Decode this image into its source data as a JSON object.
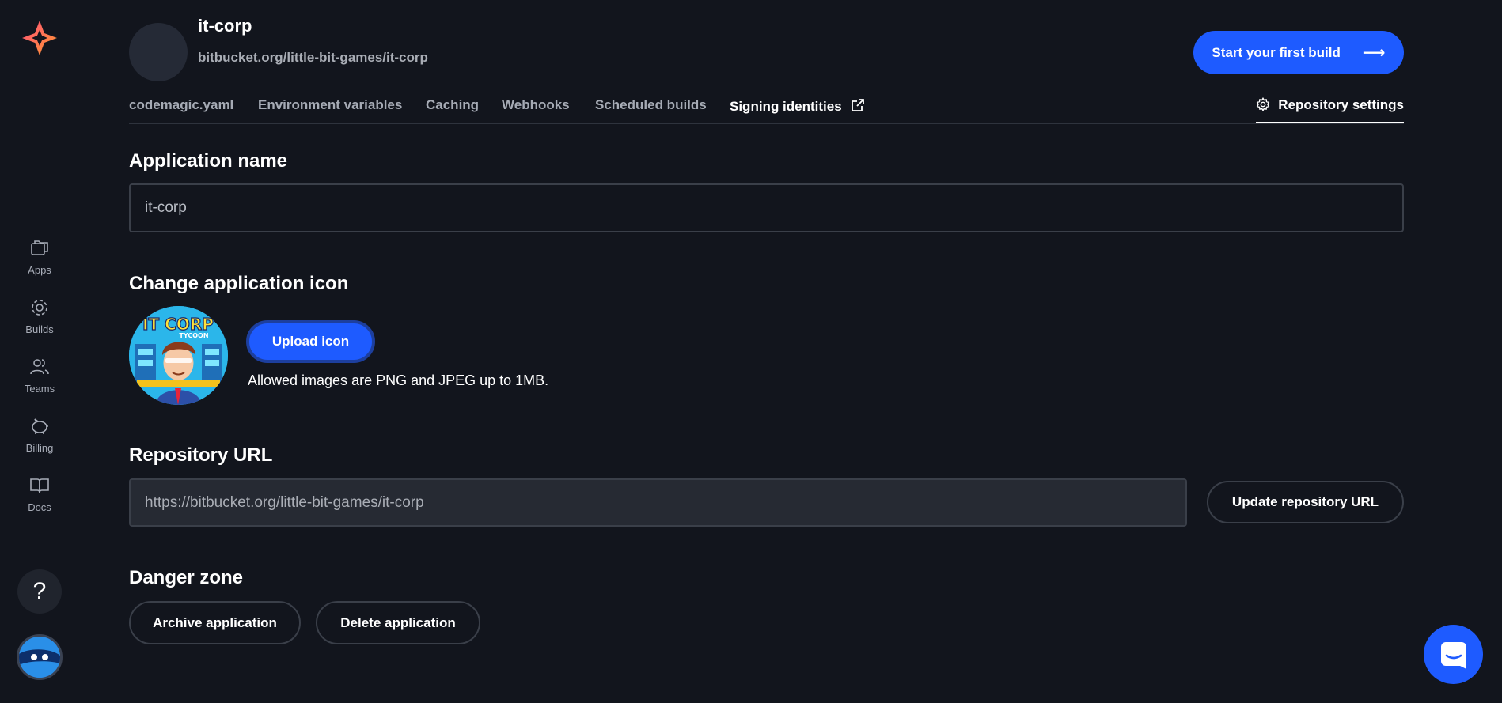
{
  "sidebar": {
    "items": [
      {
        "label": "Apps",
        "icon": "apps-icon"
      },
      {
        "label": "Builds",
        "icon": "builds-icon"
      },
      {
        "label": "Teams",
        "icon": "teams-icon"
      },
      {
        "label": "Billing",
        "icon": "billing-icon"
      },
      {
        "label": "Docs",
        "icon": "docs-icon"
      }
    ],
    "help_label": "?"
  },
  "header": {
    "app_name": "it-corp",
    "repo_path": "bitbucket.org/little-bit-games/it-corp",
    "start_build_label": "Start your first build",
    "start_build_arrow": "⟶"
  },
  "tabs": [
    {
      "label": "codemagic.yaml"
    },
    {
      "label": "Environment variables"
    },
    {
      "label": "Caching"
    },
    {
      "label": "Webhooks"
    },
    {
      "label": "Scheduled builds"
    },
    {
      "label": "Signing identities"
    }
  ],
  "settings_tab": {
    "label": "Repository settings"
  },
  "application_name": {
    "title": "Application name",
    "value": "it-corp"
  },
  "app_icon": {
    "title": "Change application icon",
    "upload_label": "Upload icon",
    "hint": "Allowed images are PNG and JPEG up to 1MB.",
    "logo_text_main": "IT CORP",
    "logo_text_sub": "TYCOON"
  },
  "repository_url": {
    "title": "Repository URL",
    "value": "https://bitbucket.org/little-bit-games/it-corp",
    "update_label": "Update repository URL"
  },
  "danger_zone": {
    "title": "Danger zone",
    "archive_label": "Archive application",
    "delete_label": "Delete application"
  },
  "colors": {
    "background": "#12151d",
    "accent": "#1e5bff",
    "muted_text": "#a6abb5",
    "border": "#3a3f49"
  }
}
